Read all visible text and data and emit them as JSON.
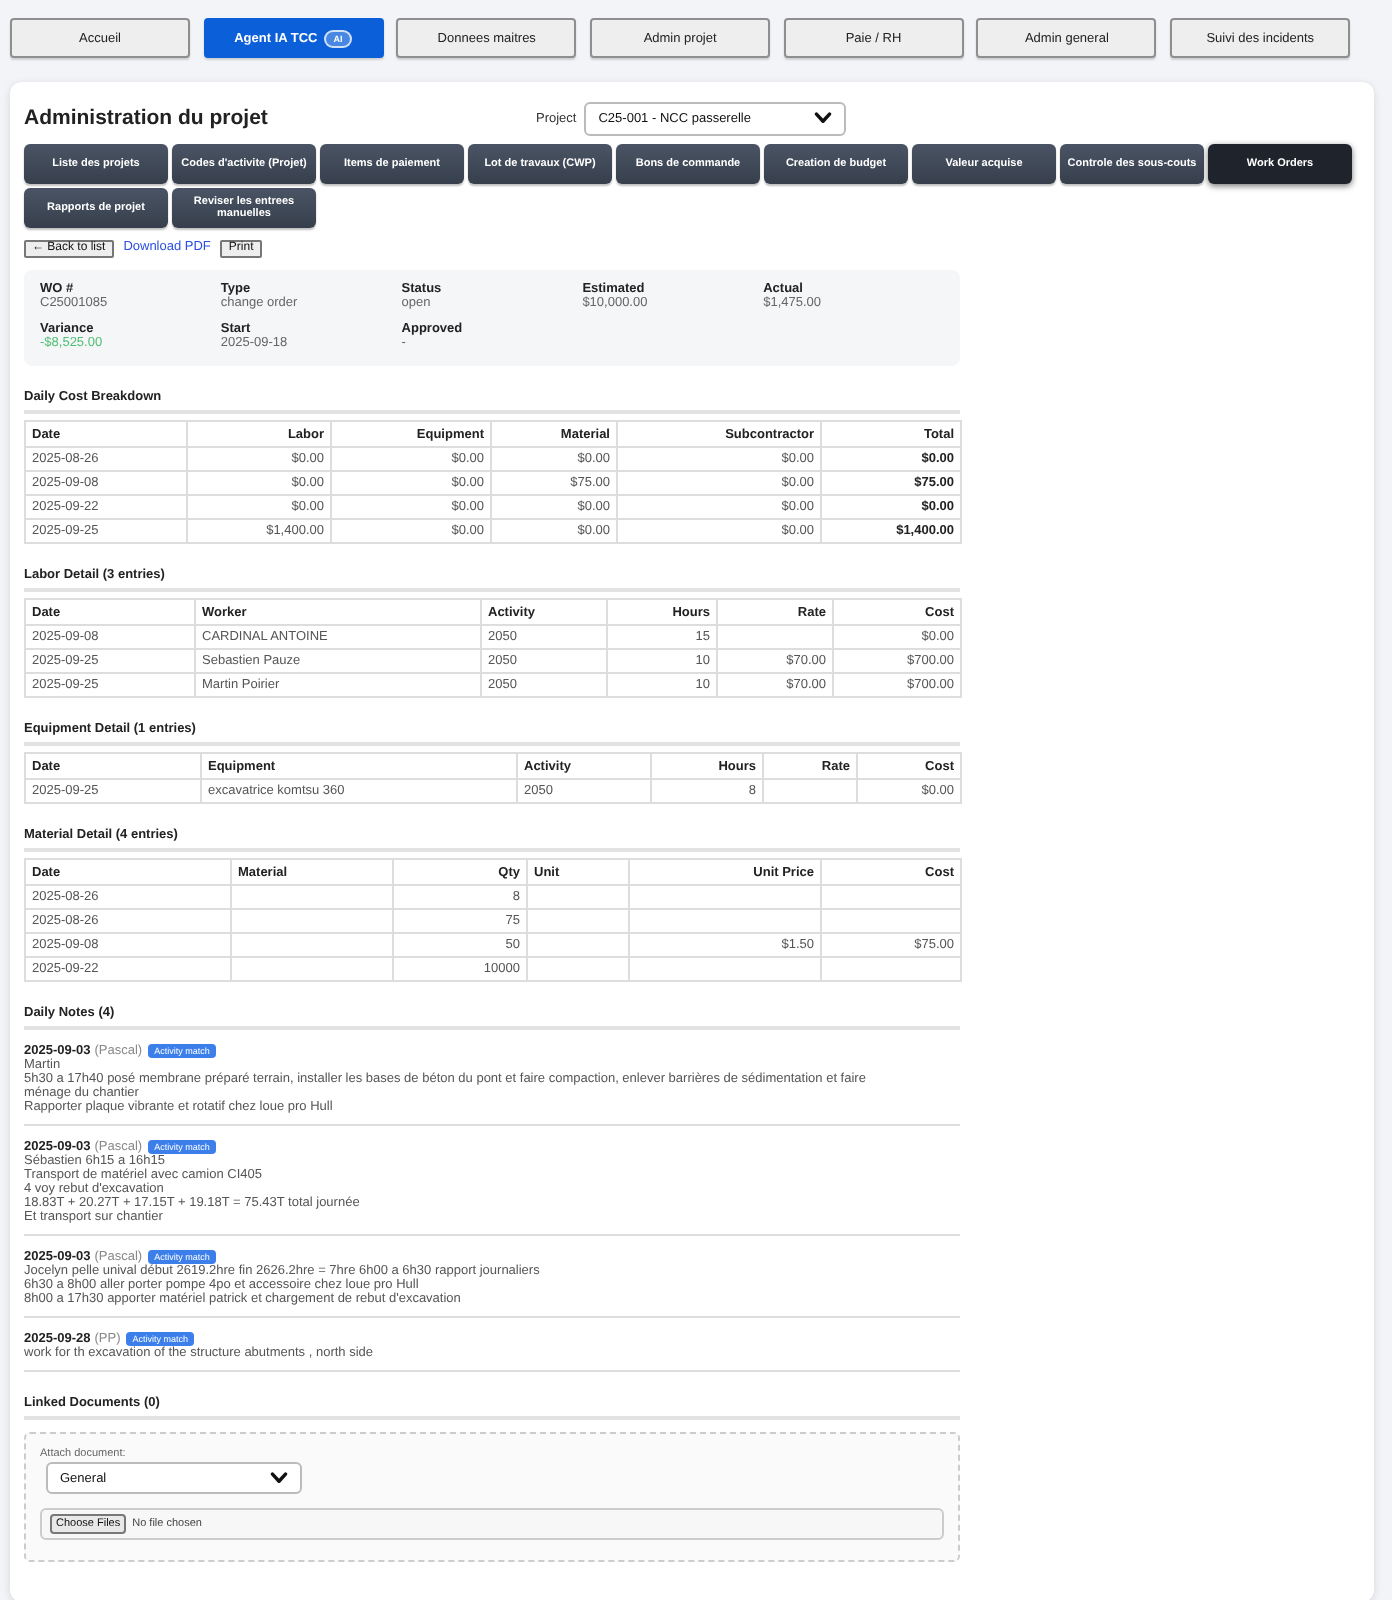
{
  "nav": {
    "tabs": [
      {
        "label": "Accueil",
        "selected": false
      },
      {
        "label": "Agent IA TCC",
        "badge": "AI",
        "selected": true
      },
      {
        "label": "Donnees maitres",
        "selected": false
      },
      {
        "label": "Admin projet",
        "selected": false
      },
      {
        "label": "Paie / RH",
        "selected": false
      },
      {
        "label": "Admin general",
        "selected": false
      },
      {
        "label": "Suivi des incidents",
        "selected": false
      }
    ]
  },
  "page": {
    "title": "Administration du projet",
    "project_selector": {
      "label": "Project",
      "value": "C25-001 - NCC passerelle"
    }
  },
  "module_buttons": [
    {
      "label": "Liste des projets",
      "selected": false
    },
    {
      "label": "Codes d'activite (Projet)",
      "selected": false
    },
    {
      "label": "Items de paiement",
      "selected": false
    },
    {
      "label": "Lot de travaux (CWP)",
      "selected": false
    },
    {
      "label": "Bons de commande",
      "selected": false
    },
    {
      "label": "Creation de budget",
      "selected": false
    },
    {
      "label": "Valeur acquise",
      "selected": false
    },
    {
      "label": "Controle des sous-couts",
      "selected": false
    },
    {
      "label": "Work Orders",
      "selected": true
    },
    {
      "label": "Rapports de projet",
      "selected": false
    },
    {
      "label": "Reviser les entrees manuelles",
      "selected": false
    }
  ],
  "actions": {
    "back": "← Back to list",
    "download": "Download PDF",
    "print": "Print"
  },
  "work_order": {
    "fields": [
      {
        "label": "WO #",
        "value": "C25001085",
        "favorable": false
      },
      {
        "label": "Type",
        "value": "change order",
        "favorable": false
      },
      {
        "label": "Status",
        "value": "open",
        "favorable": false
      },
      {
        "label": "Estimated",
        "value": "$10,000.00",
        "favorable": false
      },
      {
        "label": "Actual",
        "value": "$1,475.00",
        "favorable": false
      },
      {
        "label": "Variance",
        "value": "-$8,525.00",
        "favorable": true
      },
      {
        "label": "Start",
        "value": "2025-09-18",
        "favorable": false
      },
      {
        "label": "Approved",
        "value": "-",
        "favorable": false
      }
    ]
  },
  "tables": [
    {
      "title": "Daily Cost Breakdown",
      "columns": [
        {
          "label": "Date",
          "kind": "text"
        },
        {
          "label": "Labor",
          "kind": "amount"
        },
        {
          "label": "Equipment",
          "kind": "amount"
        },
        {
          "label": "Material",
          "kind": "amount"
        },
        {
          "label": "Subcontractor",
          "kind": "amount"
        },
        {
          "label": "Total",
          "kind": "total"
        }
      ],
      "rows": [
        [
          "2025-08-26",
          "$0.00",
          "$0.00",
          "$0.00",
          "$0.00",
          "$0.00"
        ],
        [
          "2025-09-08",
          "$0.00",
          "$0.00",
          "$75.00",
          "$0.00",
          "$75.00"
        ],
        [
          "2025-09-22",
          "$0.00",
          "$0.00",
          "$0.00",
          "$0.00",
          "$0.00"
        ],
        [
          "2025-09-25",
          "$1,400.00",
          "$0.00",
          "$0.00",
          "$0.00",
          "$1,400.00"
        ]
      ]
    },
    {
      "title": "Labor Detail (3 entries)",
      "columns": [
        {
          "label": "Date",
          "kind": "text"
        },
        {
          "label": "Worker",
          "kind": "text"
        },
        {
          "label": "Activity",
          "kind": "text"
        },
        {
          "label": "Hours",
          "kind": "amount"
        },
        {
          "label": "Rate",
          "kind": "amount"
        },
        {
          "label": "Cost",
          "kind": "amount"
        }
      ],
      "rows": [
        [
          "2025-09-08",
          "CARDINAL ANTOINE",
          "2050",
          "15",
          null,
          "$0.00"
        ],
        [
          "2025-09-25",
          "Sebastien Pauze",
          "2050",
          "10",
          "$70.00",
          "$700.00"
        ],
        [
          "2025-09-25",
          "Martin Poirier",
          "2050",
          "10",
          "$70.00",
          "$700.00"
        ]
      ]
    },
    {
      "title": "Equipment Detail (1 entries)",
      "columns": [
        {
          "label": "Date",
          "kind": "text"
        },
        {
          "label": "Equipment",
          "kind": "text"
        },
        {
          "label": "Activity",
          "kind": "text"
        },
        {
          "label": "Hours",
          "kind": "amount"
        },
        {
          "label": "Rate",
          "kind": "amount"
        },
        {
          "label": "Cost",
          "kind": "amount"
        }
      ],
      "rows": [
        [
          "2025-09-25",
          "excavatrice komtsu 360",
          "2050",
          "8",
          null,
          "$0.00"
        ]
      ]
    },
    {
      "title": "Material Detail (4 entries)",
      "columns": [
        {
          "label": "Date",
          "kind": "text"
        },
        {
          "label": "Material",
          "kind": "text"
        },
        {
          "label": "Qty",
          "kind": "amount"
        },
        {
          "label": "Unit",
          "kind": "text"
        },
        {
          "label": "Unit Price",
          "kind": "amount"
        },
        {
          "label": "Cost",
          "kind": "amount"
        }
      ],
      "rows": [
        [
          "2025-08-26",
          null,
          "8",
          null,
          null,
          null
        ],
        [
          "2025-08-26",
          null,
          "75",
          null,
          null,
          null
        ],
        [
          "2025-09-08",
          null,
          "50",
          null,
          "$1.50",
          "$75.00"
        ],
        [
          "2025-09-22",
          null,
          "10000",
          null,
          null,
          null
        ]
      ]
    }
  ],
  "daily_notes": {
    "title": "Daily Notes (4)",
    "notes": [
      {
        "date": "2025-09-03",
        "author": "(Pascal)",
        "badge": "Activity match",
        "lines": [
          "Martin",
          "5h30 a 17h40 posé membrane préparé terrain, installer les bases de béton du pont et faire compaction, enlever barrières de sédimentation et faire ménage du chantier",
          "Rapporter plaque vibrante et rotatif chez loue pro Hull"
        ]
      },
      {
        "date": "2025-09-03",
        "author": "(Pascal)",
        "badge": "Activity match",
        "lines": [
          "Sébastien 6h15 a 16h15",
          "Transport de matériel avec camion CI405",
          "4 voy rebut d'excavation",
          "18.83T + 20.27T + 17.15T + 19.18T = 75.43T total journée",
          "Et transport sur chantier"
        ]
      },
      {
        "date": "2025-09-03",
        "author": "(Pascal)",
        "badge": "Activity match",
        "lines": [
          "Jocelyn pelle unival début 2619.2hre fin 2626.2hre = 7hre 6h00 a 6h30 rapport journaliers",
          "6h30 a 8h00  aller porter pompe 4po et accessoire chez loue pro Hull",
          "8h00 a 17h30 apporter matériel patrick et chargement de rebut d'excavation"
        ]
      },
      {
        "date": "2025-09-28",
        "author": "(PP)",
        "badge": "Activity match",
        "lines": [
          "work for th excavation of the structure abutments , north side"
        ]
      }
    ]
  },
  "linked_documents": {
    "title": "Linked Documents (0)",
    "attach_label": "Attach document:",
    "category": "General",
    "file_button": "Choose Files",
    "file_status": "No file chosen"
  }
}
